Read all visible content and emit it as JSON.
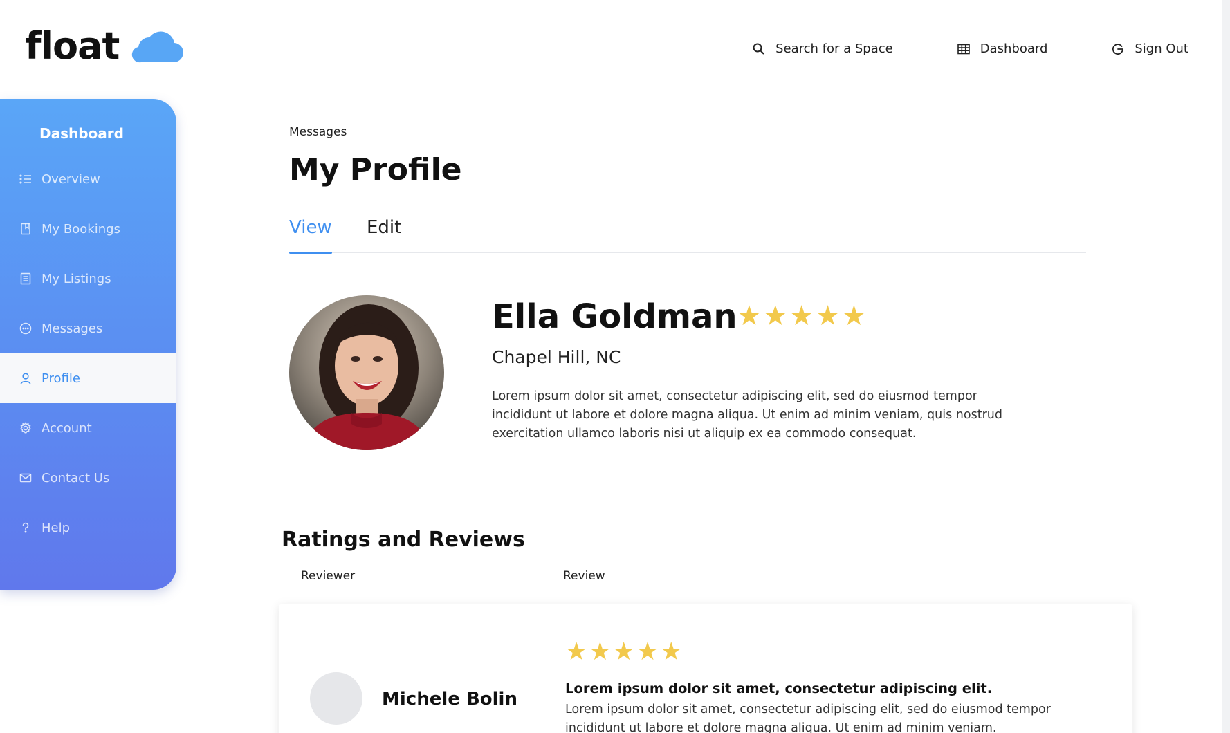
{
  "brand": {
    "name": "float",
    "accent": "#3f8ff0",
    "cloud_color": "#58a6f5",
    "star_color": "#f2c94c"
  },
  "top_nav": {
    "search": {
      "icon": "search-icon",
      "label": "Search for a Space"
    },
    "dashboard": {
      "icon": "grid-icon",
      "label": "Dashboard"
    },
    "signout": {
      "icon": "power-icon",
      "label": "Sign Out"
    }
  },
  "sidebar": {
    "title": "Dashboard",
    "items": [
      {
        "icon": "list-icon",
        "label": "Overview",
        "active": false
      },
      {
        "icon": "bookmark-icon",
        "label": "My Bookings",
        "active": false
      },
      {
        "icon": "document-icon",
        "label": "My Listings",
        "active": false
      },
      {
        "icon": "chat-icon",
        "label": "Messages",
        "active": false
      },
      {
        "icon": "user-icon",
        "label": "Profile",
        "active": true
      },
      {
        "icon": "gear-icon",
        "label": "Account",
        "active": false
      },
      {
        "icon": "mail-icon",
        "label": "Contact Us",
        "active": false
      },
      {
        "icon": "question-icon",
        "label": "Help",
        "active": false
      }
    ]
  },
  "main": {
    "breadcrumb": "Messages",
    "title": "My Profile",
    "tabs": [
      {
        "label": "View",
        "active": true
      },
      {
        "label": "Edit",
        "active": false
      }
    ]
  },
  "profile": {
    "name": "Ella Goldman",
    "rating": 5,
    "stars": "★★★★★",
    "location": "Chapel Hill, NC",
    "bio": "Lorem ipsum dolor sit amet, consectetur adipiscing elit, sed do eiusmod tempor incididunt ut labore et dolore magna aliqua. Ut enim ad minim veniam, quis nostrud exercitation ullamco laboris nisi ut aliquip ex ea commodo consequat."
  },
  "reviews": {
    "title": "Ratings and Reviews",
    "columns": {
      "reviewer": "Reviewer",
      "review": "Review"
    },
    "items": [
      {
        "reviewer": "Michele Bolin",
        "rating": 5,
        "stars": "★★★★★",
        "headline": "Lorem ipsum dolor sit amet, consectetur adipiscing elit.",
        "text": "Lorem ipsum dolor sit amet, consectetur adipiscing elit, sed do eiusmod tempor incididunt ut labore et dolore magna aliqua. Ut enim ad minim veniam."
      }
    ]
  }
}
